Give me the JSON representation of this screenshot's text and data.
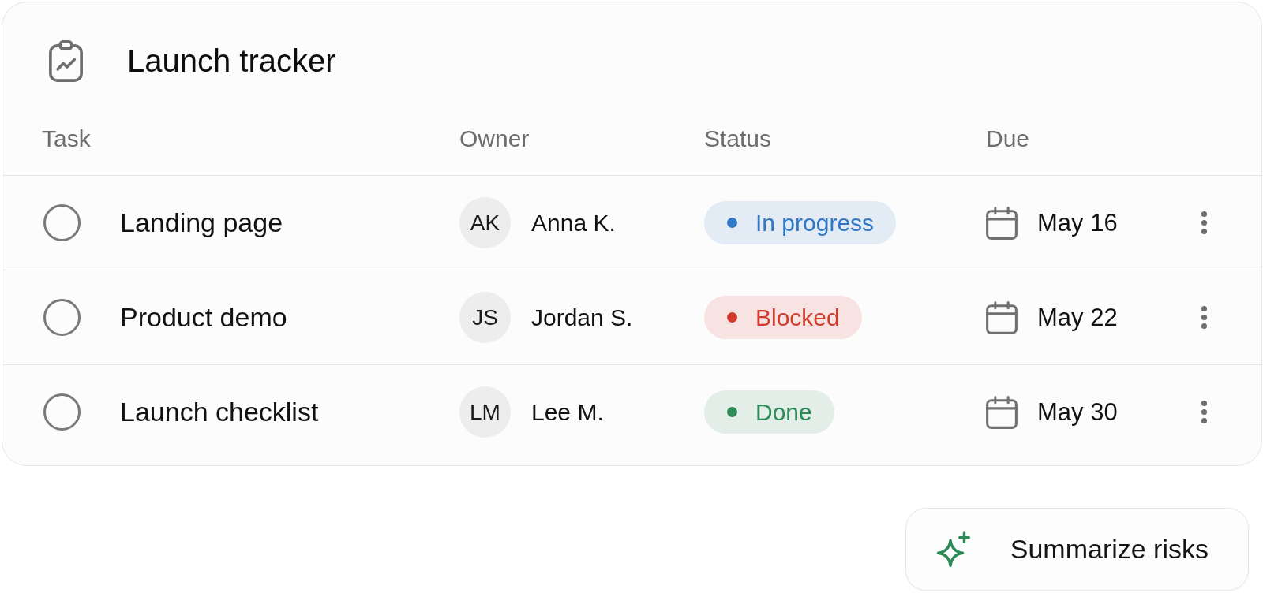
{
  "card": {
    "title": "Launch tracker"
  },
  "table": {
    "columns": [
      "Task",
      "Owner",
      "Status",
      "Due"
    ],
    "rows": [
      {
        "checked": false,
        "task": "Landing page",
        "owner_initials": "AK",
        "owner": "Anna K.",
        "status": {
          "label": "In progress",
          "color": "#2f78c6"
        },
        "due": "May 16"
      },
      {
        "checked": false,
        "task": "Product demo",
        "owner_initials": "JS",
        "owner": "Jordan S.",
        "status": {
          "label": "Blocked",
          "color": "#d33a2c"
        },
        "due": "May 22"
      },
      {
        "checked": false,
        "task": "Launch checklist",
        "owner_initials": "LM",
        "owner": "Lee M.",
        "status": {
          "label": "Done",
          "color": "#2e8b57"
        },
        "due": "May 30"
      }
    ]
  },
  "action_button": {
    "label": "Summarize risks"
  }
}
